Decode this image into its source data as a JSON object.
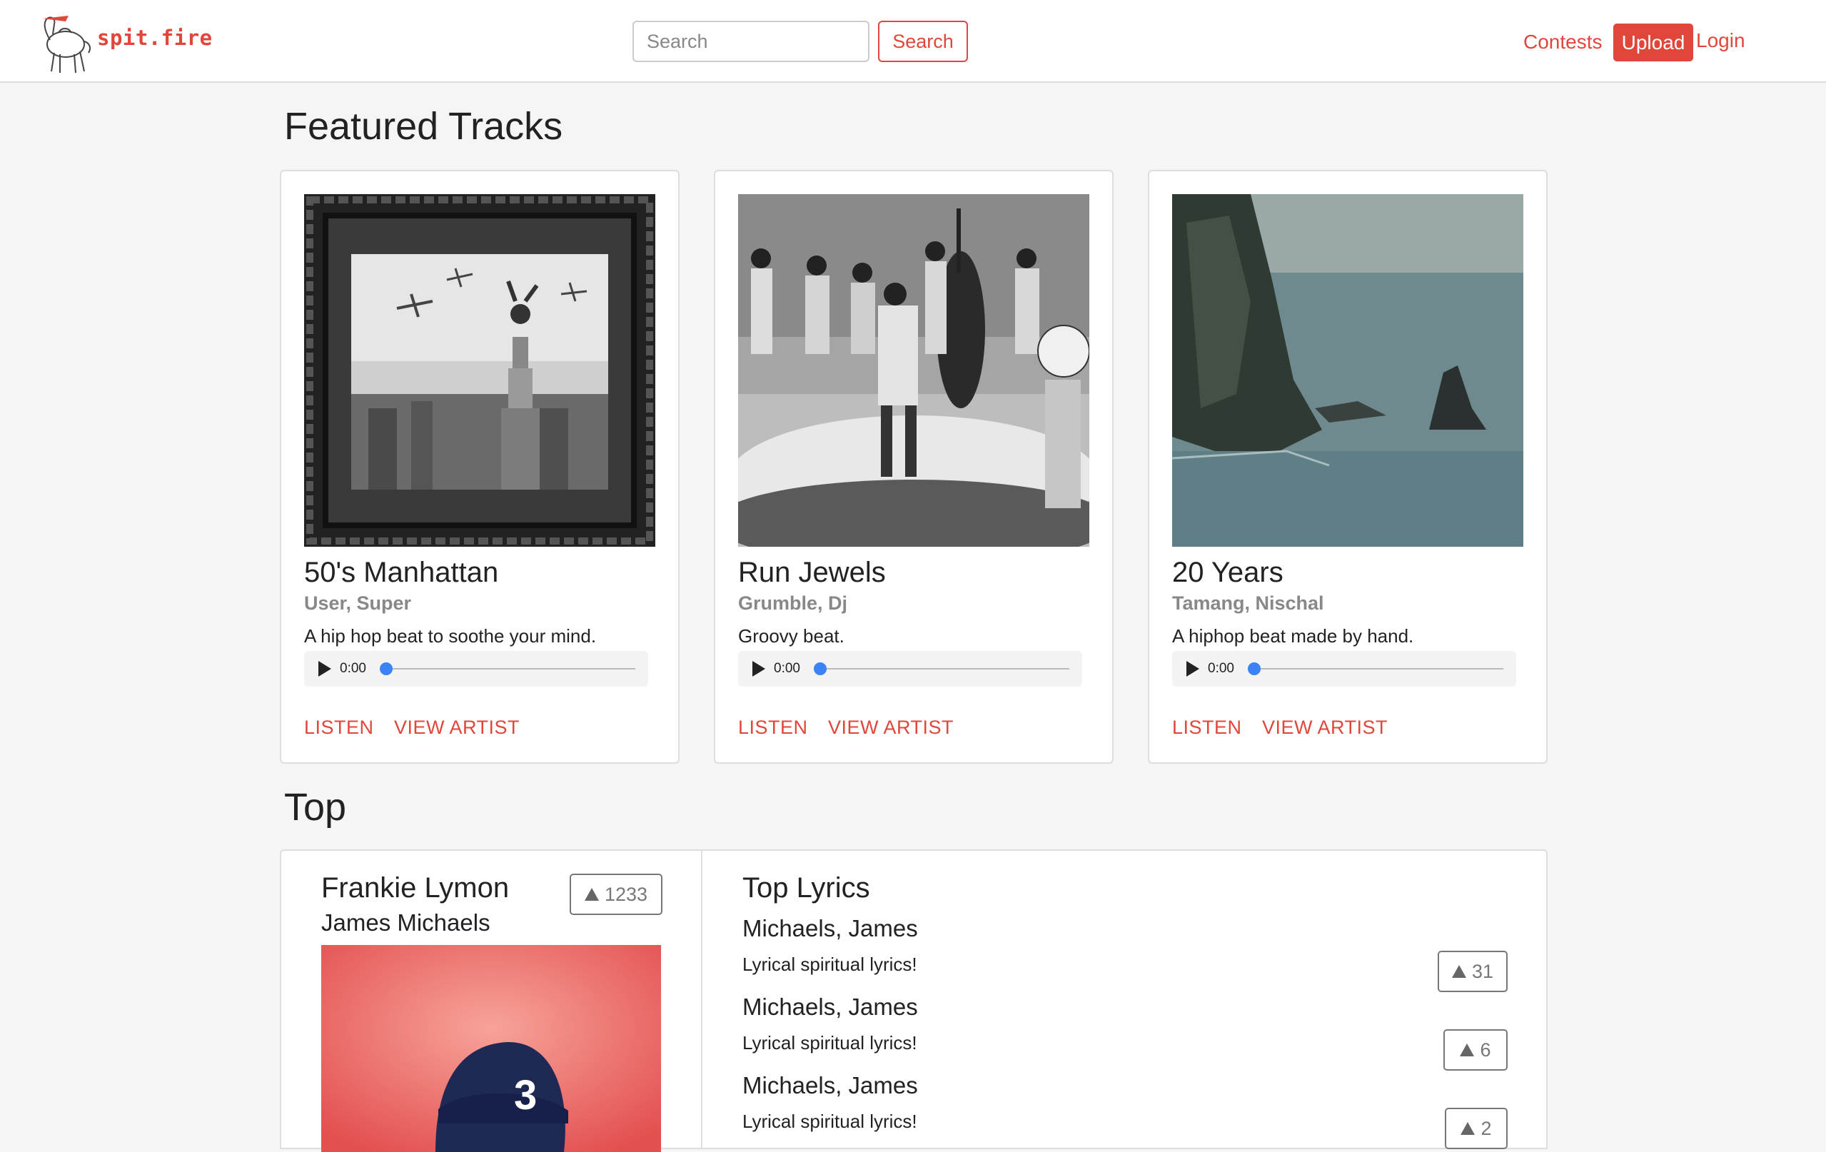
{
  "nav": {
    "brand": "spit.fire",
    "search_placeholder": "Search",
    "search_button": "Search",
    "contests": "Contests",
    "upload": "Upload",
    "login": "Login"
  },
  "featured": {
    "heading": "Featured Tracks",
    "cards": [
      {
        "title": "50's Manhattan",
        "artist": "User, Super",
        "description": "A hip hop beat to soothe your mind.",
        "time": "0:00",
        "listen": "LISTEN",
        "view_artist": "VIEW ARTIST",
        "progress": 0
      },
      {
        "title": "Run Jewels",
        "artist": "Grumble, Dj",
        "description": "Groovy beat.",
        "time": "0:00",
        "listen": "LISTEN",
        "view_artist": "VIEW ARTIST",
        "progress": 0
      },
      {
        "title": "20 Years",
        "artist": "Tamang, Nischal",
        "description": "A hiphop beat made by hand.",
        "time": "0:00",
        "listen": "LISTEN",
        "view_artist": "VIEW ARTIST",
        "progress": 0
      }
    ]
  },
  "top": {
    "heading": "Top",
    "artist": {
      "name": "Frankie Lymon",
      "subtitle": "James Michaels",
      "votes": "1233"
    },
    "lyrics": {
      "heading": "Top Lyrics",
      "items": [
        {
          "author": "Michaels, James",
          "text": "Lyrical spiritual lyrics!",
          "votes": "31"
        },
        {
          "author": "Michaels, James",
          "text": "Lyrical spiritual lyrics!",
          "votes": "6"
        },
        {
          "author": "Michaels, James",
          "text": "Lyrical spiritual lyrics!",
          "votes": "2"
        }
      ]
    }
  },
  "colors": {
    "accent": "#e0473a",
    "player_knob": "#3b82f6"
  }
}
